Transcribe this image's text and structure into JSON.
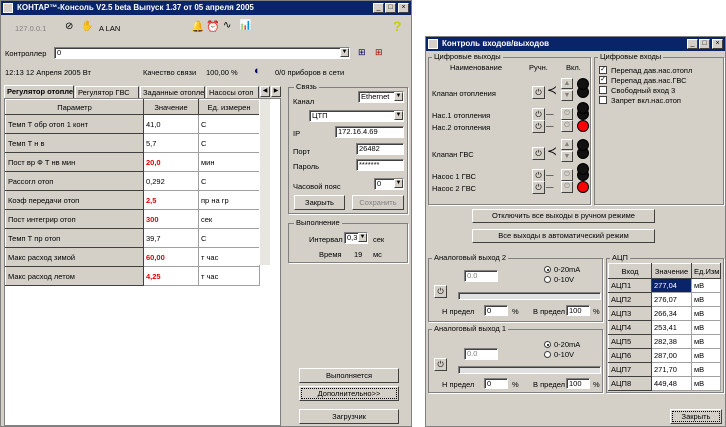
{
  "main": {
    "title": "КОНТАР™-Консоль V2.5 beta Выпуск 1.37 от 05 апреля 2005",
    "toolbar_text": "127.0.0.1",
    "lan_label": "A  LAN",
    "controller_label": "Контроллер",
    "controller_value": "0",
    "datetime": "12:13 12 Апреля 2005 Вт",
    "quality_label": "Качество связи",
    "quality_value": "100,00 %",
    "devices_status": "0/0 приборов в сети",
    "tabs": [
      "Регулятор отопле",
      "Регулятор ГВС",
      "Заданные отоплени",
      "Насосы отоп"
    ],
    "table": {
      "headers": [
        "Параметр",
        "Значение",
        "Ед. измерен"
      ],
      "rows": [
        {
          "param": "Темп Т обр отоп 1 конт",
          "value": "41,0",
          "unit": "С",
          "red": false
        },
        {
          "param": "Темп Т н в",
          "value": "5,7",
          "unit": "С",
          "red": false
        },
        {
          "param": "Пост вр Ф Т нв мин",
          "value": "20,0",
          "unit": "мин",
          "red": true
        },
        {
          "param": "Рассогл отоп",
          "value": "0,292",
          "unit": "С",
          "red": false
        },
        {
          "param": "Коэф передачи отоп",
          "value": "2,5",
          "unit": "пр на гр",
          "red": true
        },
        {
          "param": "Пост интегрир отоп",
          "value": "300",
          "unit": "сек",
          "red": true
        },
        {
          "param": "Темп Т пр отоп",
          "value": "39,7",
          "unit": "С",
          "red": false
        },
        {
          "param": "Макс расход зимой",
          "value": "60,00",
          "unit": "т час",
          "red": true
        },
        {
          "param": "Макс расход летом",
          "value": "4,25",
          "unit": "т час",
          "red": true
        }
      ]
    },
    "link": {
      "group": "Связь",
      "channel_label": "Канал",
      "channel_value": "Ethernet",
      "server_value": "ЦТП",
      "ip_label": "IP",
      "ip_value": "172.16.4.69",
      "port_label": "Порт",
      "port_value": "26482",
      "password_label": "Пароль",
      "password_value": "*******",
      "tz_label": "Часовой пояс",
      "tz_value": "0",
      "close_btn": "Закрыть",
      "save_btn": "Сохранить"
    },
    "exec": {
      "group": "Выполнение",
      "interval_label": "Интервал",
      "interval_value": "0,3",
      "interval_unit": "сек",
      "time_label": "Время",
      "time_value": "19",
      "time_unit": "мс"
    },
    "running_btn": "Выполняется",
    "more_btn": "Дополнительно>>",
    "load_btn": "Загрузчик"
  },
  "io": {
    "title": "Контроль входов/выходов",
    "digital_out": {
      "group": "Цифровые выходы",
      "col_name": "Наименование",
      "col_manual": "Ручн.",
      "col_on": "Вкл.",
      "items": [
        "Клапан отопления",
        "Нас.1 отопления",
        "Нас.2 отопления",
        "Клапан  ГВС",
        "Насос 1 ГВС",
        "Насос 2 ГВС"
      ]
    },
    "digital_in": {
      "group": "Цифровые входы",
      "items": [
        {
          "label": "Перепад дав.нас.отопл",
          "checked": true
        },
        {
          "label": "Перепад дав.нас.ГВС",
          "checked": true
        },
        {
          "label": "Свободный вход 3",
          "checked": false
        },
        {
          "label": "Запрет вкл.нас.отоп",
          "checked": false
        }
      ]
    },
    "btn_all_manual": "Отключить все выходы в ручном режиме",
    "btn_all_auto": "Все выходы в автоматический режим",
    "ao2": {
      "group": "Аналоговый выход 2",
      "value": "0.0",
      "opt1": "0-20mA",
      "opt2": "0-10V",
      "n_label": "Н предел",
      "n_value": "0",
      "pct": "%",
      "v_label": "В предел",
      "v_value": "100"
    },
    "ao1": {
      "group": "Аналоговый выход 1",
      "value": "0.0",
      "opt1": "0-20mA",
      "opt2": "0-10V",
      "n_label": "Н предел",
      "n_value": "0",
      "pct": "%",
      "v_label": "В предел",
      "v_value": "100"
    },
    "adc": {
      "group": "АЦП",
      "headers": [
        "Вход",
        "Значение",
        "Ед.Изм"
      ],
      "rows": [
        [
          "АЦП1",
          "277,04",
          "мВ"
        ],
        [
          "АЦП2",
          "276,07",
          "мВ"
        ],
        [
          "АЦП3",
          "266,34",
          "мВ"
        ],
        [
          "АЦП4",
          "253,41",
          "мВ"
        ],
        [
          "АЦП5",
          "282,38",
          "мВ"
        ],
        [
          "АЦП6",
          "287,00",
          "мВ"
        ],
        [
          "АЦП7",
          "271,70",
          "мВ"
        ],
        [
          "АЦП8",
          "449,48",
          "мВ"
        ]
      ]
    },
    "close_btn": "Закрыть"
  }
}
